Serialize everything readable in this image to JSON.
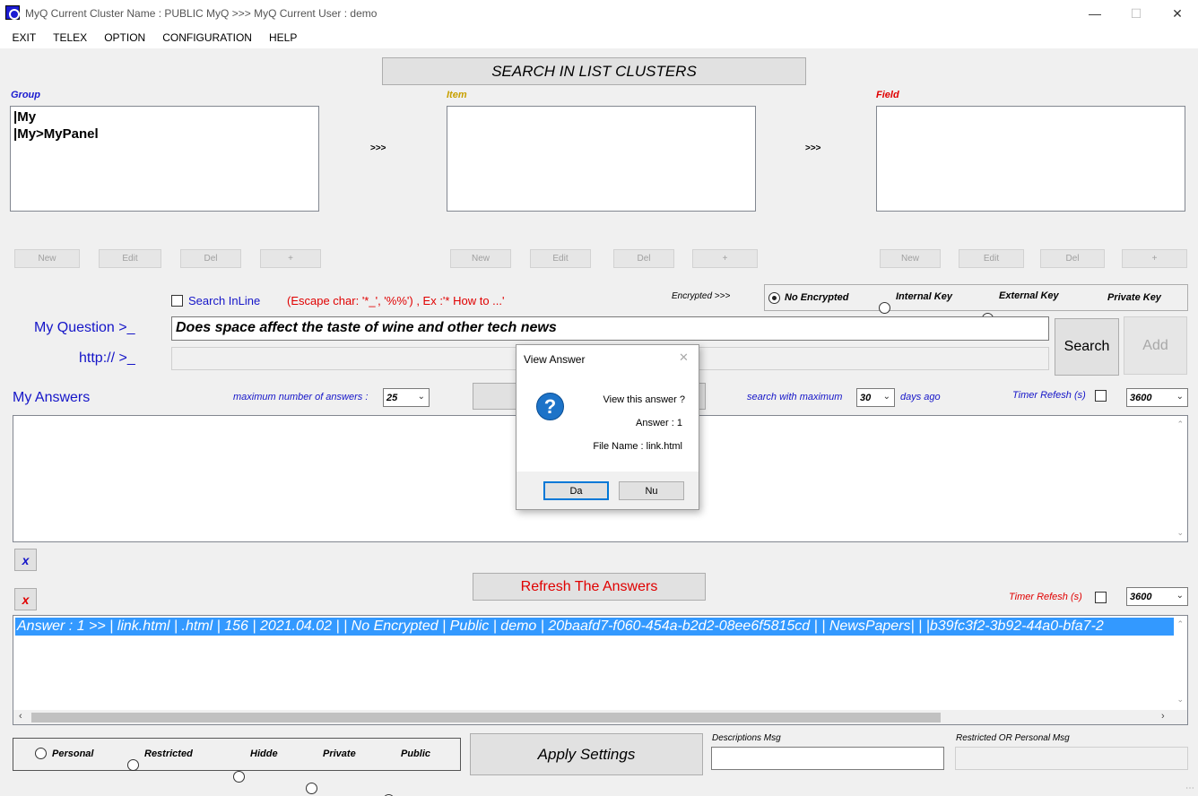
{
  "window": {
    "title": "MyQ Current Cluster Name : PUBLIC MyQ >>> MyQ Current User : demo",
    "minimize": "—",
    "maximize": "☐",
    "close": "✕"
  },
  "menu": [
    "EXIT",
    "TELEX",
    "OPTION",
    "CONFIGURATION",
    "HELP"
  ],
  "search_clusters_button": "SEARCH IN LIST CLUSTERS",
  "group": {
    "label": "Group",
    "items": [
      "|My",
      "|My>MyPanel"
    ],
    "arrow": ">>>",
    "buttons": [
      "New",
      "Edit",
      "Del",
      "+"
    ]
  },
  "item": {
    "label": "Item",
    "arrow": ">>>",
    "buttons": [
      "New",
      "Edit",
      "Del",
      "+"
    ]
  },
  "field": {
    "label": "Field",
    "buttons": [
      "New",
      "Edit",
      "Del",
      "+"
    ]
  },
  "search_inline": {
    "label": "Search InLine",
    "hint": "(Escape char: '*_', '%%') , Ex :'* How to ...'"
  },
  "encryption": {
    "label": "Encrypted >>>",
    "options": [
      "No Encrypted",
      "Internal Key",
      "External Key",
      "Private Key"
    ],
    "selected": "No Encrypted"
  },
  "question": {
    "label": "My Question >_",
    "value": "Does space affect the taste of wine and other tech news",
    "url_label": "http:// >_",
    "url_value": ""
  },
  "search_button": "Search",
  "add_button": "Add",
  "answers": {
    "label": "My Answers",
    "max_answers_label": "maximum number of answers :",
    "max_answers_value": "25",
    "search_max_label": "search with maximum",
    "search_max_value": "30",
    "days_ago": "days ago",
    "timer_label": "Timer Refesh (s)",
    "timer_value": "3600"
  },
  "clear_x_blue": "x",
  "clear_x_red": "x",
  "refresh_button": "Refresh The Answers",
  "timer2": {
    "label": "Timer Refesh (s)",
    "value": "3600"
  },
  "results": [
    "Answer : 1 >> | link.html | .html | 156 | 2021.04.02 |  | No Encrypted | Public | demo | 20baafd7-f060-454a-b2d2-08ee6f5815cd |  | NewsPapers|   | |b39fc3f2-3b92-44a0-bfa7-2"
  ],
  "visibility": {
    "options": [
      "Personal",
      "Restricted",
      "Hidde",
      "Private",
      "Public"
    ],
    "selected": "Public"
  },
  "apply_button": "Apply Settings",
  "descriptions_msg": {
    "label": "Descriptions Msg",
    "value": ""
  },
  "restricted_msg": {
    "label": "Restricted OR Personal Msg",
    "value": ""
  },
  "dialog": {
    "title": "View Answer",
    "line1": "View this answer ?",
    "line2": "Answer : 1",
    "line3": "File Name :  link.html",
    "yes": "Da",
    "no": "Nu",
    "close": "✕",
    "icon": "?"
  },
  "colors": {
    "group_label": "#1a1ad0",
    "item_label": "#c8a000",
    "field_label": "#e00000",
    "selection": "#3399ff",
    "refresh_text": "#e00000"
  }
}
